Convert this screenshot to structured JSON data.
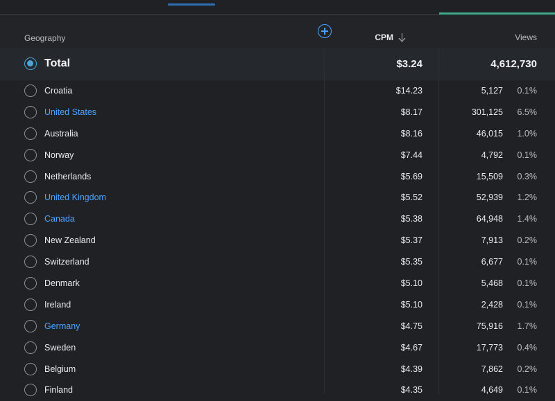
{
  "header": {
    "geography": "Geography",
    "cpm": "CPM",
    "views": "Views"
  },
  "total": {
    "label": "Total",
    "cpm": "$3.24",
    "views": "4,612,730",
    "selected": true
  },
  "rows": [
    {
      "country": "Croatia",
      "link": false,
      "cpm": "$14.23",
      "views": "5,127",
      "pct": "0.1%"
    },
    {
      "country": "United States",
      "link": true,
      "cpm": "$8.17",
      "views": "301,125",
      "pct": "6.5%"
    },
    {
      "country": "Australia",
      "link": false,
      "cpm": "$8.16",
      "views": "46,015",
      "pct": "1.0%"
    },
    {
      "country": "Norway",
      "link": false,
      "cpm": "$7.44",
      "views": "4,792",
      "pct": "0.1%"
    },
    {
      "country": "Netherlands",
      "link": false,
      "cpm": "$5.69",
      "views": "15,509",
      "pct": "0.3%"
    },
    {
      "country": "United Kingdom",
      "link": true,
      "cpm": "$5.52",
      "views": "52,939",
      "pct": "1.2%"
    },
    {
      "country": "Canada",
      "link": true,
      "cpm": "$5.38",
      "views": "64,948",
      "pct": "1.4%"
    },
    {
      "country": "New Zealand",
      "link": false,
      "cpm": "$5.37",
      "views": "7,913",
      "pct": "0.2%"
    },
    {
      "country": "Switzerland",
      "link": false,
      "cpm": "$5.35",
      "views": "6,677",
      "pct": "0.1%"
    },
    {
      "country": "Denmark",
      "link": false,
      "cpm": "$5.10",
      "views": "5,468",
      "pct": "0.1%"
    },
    {
      "country": "Ireland",
      "link": false,
      "cpm": "$5.10",
      "views": "2,428",
      "pct": "0.1%"
    },
    {
      "country": "Germany",
      "link": true,
      "cpm": "$4.75",
      "views": "75,916",
      "pct": "1.7%"
    },
    {
      "country": "Sweden",
      "link": false,
      "cpm": "$4.67",
      "views": "17,773",
      "pct": "0.4%"
    },
    {
      "country": "Belgium",
      "link": false,
      "cpm": "$4.39",
      "views": "7,862",
      "pct": "0.2%"
    },
    {
      "country": "Finland",
      "link": false,
      "cpm": "$4.35",
      "views": "4,649",
      "pct": "0.1%"
    }
  ],
  "colors": {
    "background": "#1f2124",
    "link": "#4da3ff",
    "radio_selected": "#4ba3d8",
    "views_accent": "#3fa98a",
    "tab_indicator": "#2f6fb5"
  },
  "icons": {
    "add_metric": "plus-circle-icon",
    "sort": "arrow-down-icon"
  }
}
